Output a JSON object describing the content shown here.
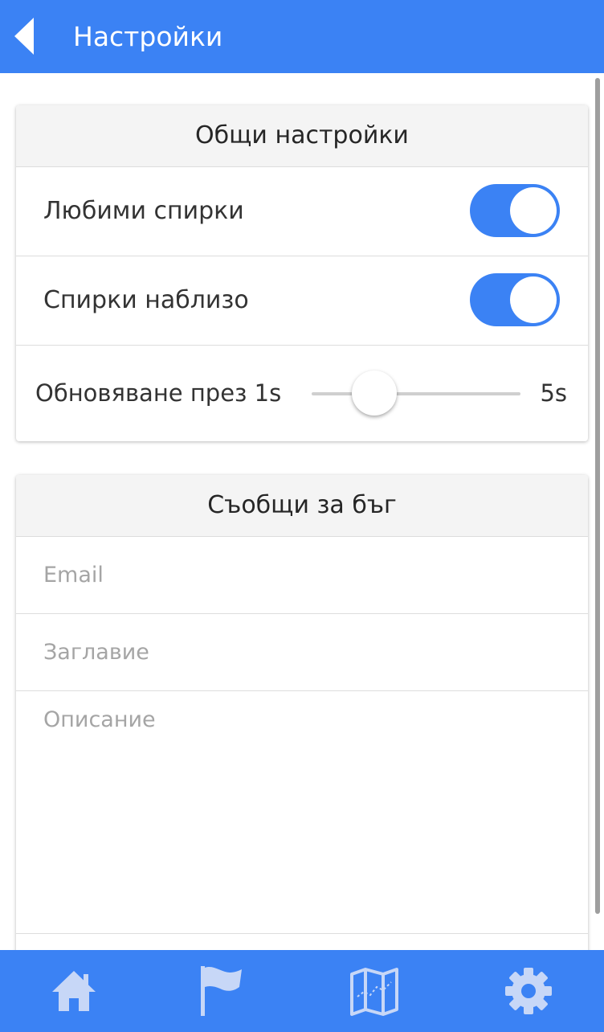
{
  "header": {
    "title": "Настройки",
    "back_icon": "back-arrow-icon"
  },
  "general": {
    "title": "Общи настройки",
    "favorites_label": "Любими спирки",
    "favorites_enabled": true,
    "nearby_label": "Спирки наблизо",
    "nearby_enabled": true,
    "refresh_label": "Обновяване през 1s",
    "refresh_max": "5s",
    "refresh_value_seconds": 1
  },
  "bug_report": {
    "title": "Съобщи за бъг",
    "email_placeholder": "Email",
    "title_placeholder": "Заглавие",
    "description_placeholder": "Описание"
  },
  "bottom_nav": {
    "items": [
      {
        "icon": "home-icon"
      },
      {
        "icon": "flag-icon"
      },
      {
        "icon": "map-icon"
      },
      {
        "icon": "gear-icon"
      }
    ]
  },
  "colors": {
    "accent": "#3b82f4",
    "nav_icon": "#c7d7f7"
  }
}
